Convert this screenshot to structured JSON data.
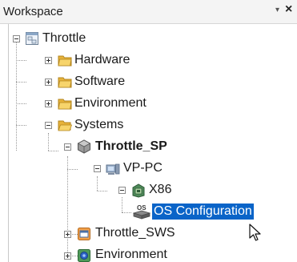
{
  "panel": {
    "title": "Workspace",
    "menu_glyph": "▾",
    "close_glyph": "×"
  },
  "tree": {
    "throttle": {
      "label": "Throttle",
      "icon": "project-icon"
    },
    "hardware": {
      "label": "Hardware",
      "icon": "folder-icon"
    },
    "software": {
      "label": "Software",
      "icon": "folder-icon"
    },
    "environment_folder": {
      "label": "Environment",
      "icon": "folder-icon"
    },
    "systems": {
      "label": "Systems",
      "icon": "folder-icon"
    },
    "throttle_sp": {
      "label": "Throttle_SP",
      "icon": "system-cube-icon"
    },
    "vp_pc": {
      "label": "VP-PC",
      "icon": "pc-icon"
    },
    "x86": {
      "label": "X86",
      "icon": "processor-icon"
    },
    "os_config": {
      "label": "OS Configuration",
      "icon": "os-icon",
      "icon_text": "OS",
      "selected": true
    },
    "throttle_sws": {
      "label": "Throttle_SWS",
      "icon": "software-component-icon"
    },
    "environment_comp": {
      "label": "Environment",
      "icon": "environment-component-icon"
    }
  },
  "colors": {
    "selection": "#0a64c8",
    "folder": "#f3c444"
  }
}
